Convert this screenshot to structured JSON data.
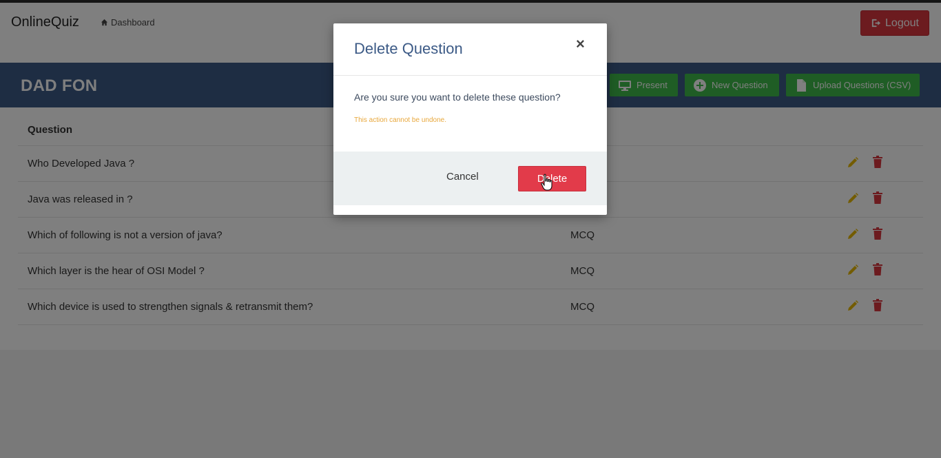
{
  "navbar": {
    "brand": "OnlineQuiz",
    "breadcrumb": "Dashboard",
    "logout_label": "Logout"
  },
  "quiz": {
    "title": "DAD FON",
    "buttons": {
      "present": "Present",
      "new_question": "New Question",
      "upload": "Upload Questions (CSV)"
    }
  },
  "table": {
    "header": "Question",
    "rows": [
      {
        "question": "Who Developed Java ?",
        "type": ""
      },
      {
        "question": "Java was released in ?",
        "type": ""
      },
      {
        "question": "Which of following is not a version of java?",
        "type": "MCQ"
      },
      {
        "question": "Which layer is the hear of OSI Model ?",
        "type": "MCQ"
      },
      {
        "question": "Which device is used to strengthen signals & retransmit them?",
        "type": "MCQ"
      }
    ]
  },
  "modal": {
    "title": "Delete Question",
    "close": "×",
    "message": "Are you sure you want to delete these question?",
    "warning": "This action cannot be undone.",
    "cancel": "Cancel",
    "delete": "Delete"
  },
  "colors": {
    "navy": "#3c5a86",
    "green": "#3fba4b",
    "red": "#e23b4a",
    "warning": "#e8a73b"
  },
  "icons": [
    "home-icon",
    "logout-icon",
    "monitor-icon",
    "plus-circle-icon",
    "file-icon",
    "pencil-icon",
    "trash-icon",
    "hand-cursor-icon"
  ]
}
